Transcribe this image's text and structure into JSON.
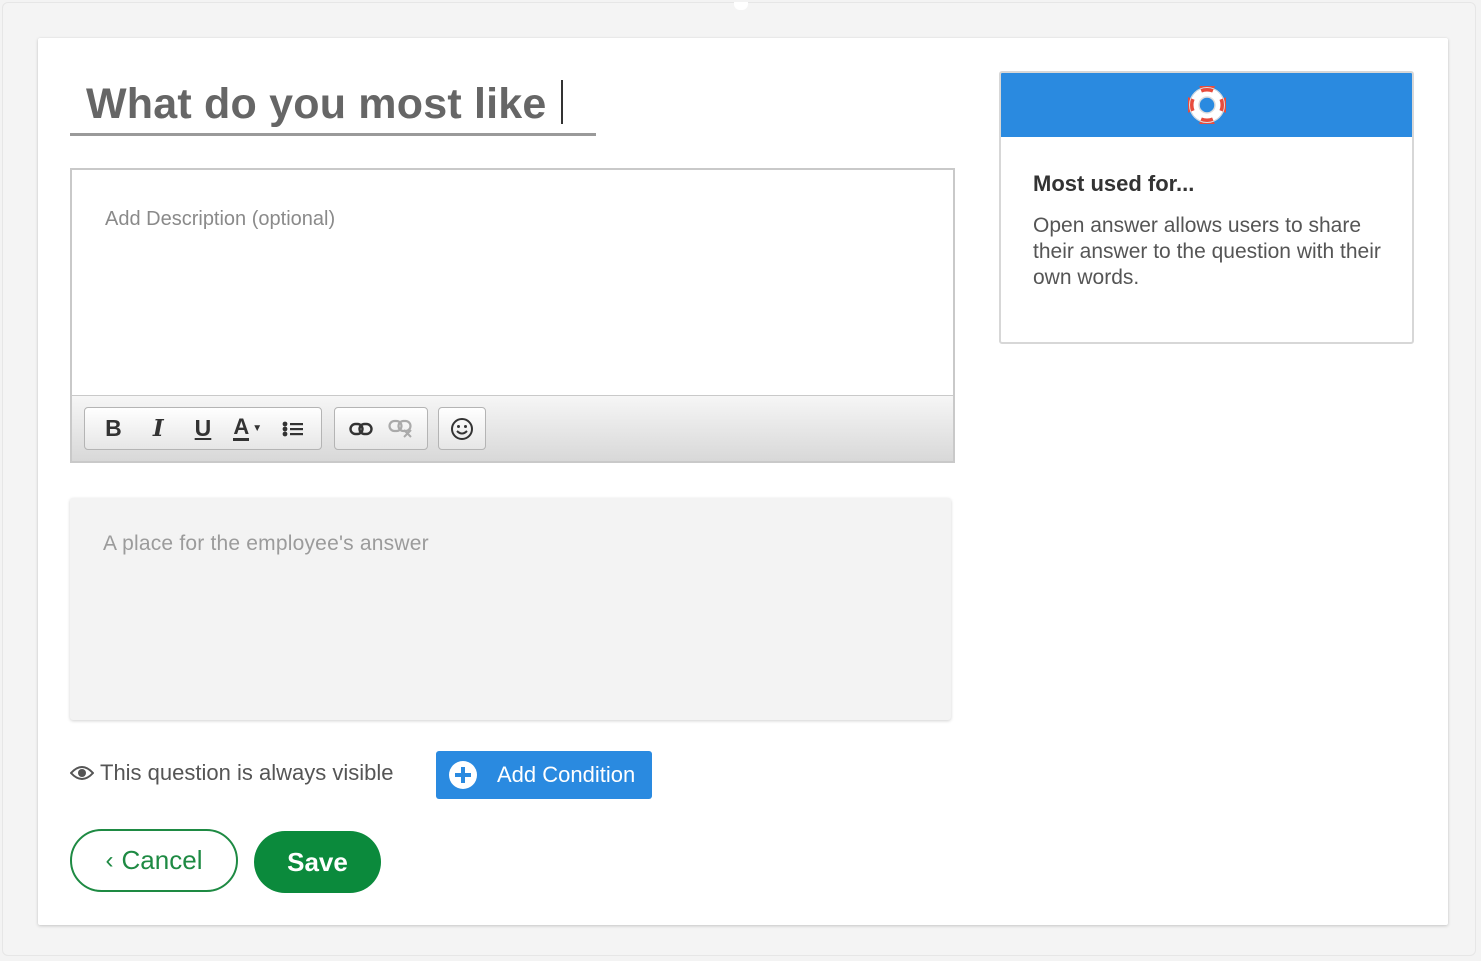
{
  "question": {
    "title_value": "What do you most like",
    "description_placeholder": "Add Description (optional)",
    "answer_placeholder": "A place for the employee's answer"
  },
  "toolbar": {
    "bold_label": "B",
    "italic_label": "I",
    "underline_label": "U",
    "font_color_label": "A",
    "icons": [
      "bulleted-list-icon",
      "link-icon",
      "unlink-icon",
      "emoji-icon"
    ]
  },
  "visibility": {
    "text": "This question is always visible",
    "add_condition_label": "Add Condition"
  },
  "actions": {
    "cancel_label": "Cancel",
    "save_label": "Save"
  },
  "info_panel": {
    "icon": "lifebuoy-icon",
    "title": "Most used for...",
    "body": "Open answer allows users to share their answer to the question with their own words."
  },
  "colors": {
    "accent_blue": "#2a8ae0",
    "save_green": "#0b8a3c",
    "cancel_green": "#1e8a43"
  }
}
